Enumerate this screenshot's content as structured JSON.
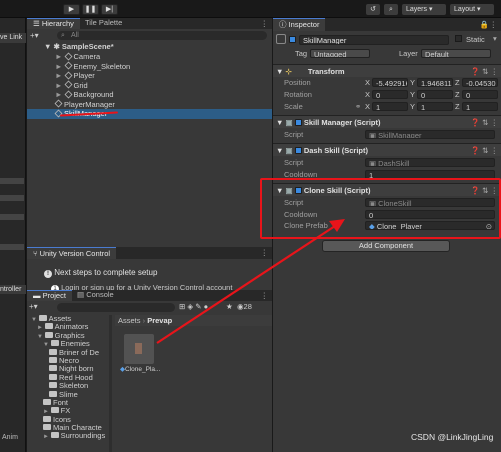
{
  "toolbar": {
    "play_icon": "play-icon",
    "pause_icon": "pause-icon",
    "step_icon": "step-icon",
    "layers_label": "Layers",
    "layout_label": "Layout"
  },
  "leftstrip": {
    "live_link": "ve Link",
    "controller": "ntroller",
    "anim": "Anim"
  },
  "hierarchy": {
    "tab_label": "Hierarchy",
    "tab2_label": "Tile Palette",
    "search_placeholder": "All",
    "scene_name": "SampleScene*",
    "items": [
      "Camera",
      "Enemy_Skeleton",
      "Player",
      "Grid",
      "Background",
      "PlayerManager",
      "SkillManager"
    ]
  },
  "uvc": {
    "tab_label": "Unity Version Control",
    "title": "Next steps to complete setup",
    "step1_num": "1",
    "step1": "Login or sign up for a Unity Version Control account"
  },
  "project": {
    "tab_label": "Project",
    "console_tab": "Console",
    "count": "28",
    "breadcrumb": [
      "Assets",
      "Prevap"
    ],
    "tree": [
      {
        "label": "Assets",
        "indent": 0,
        "arrow": "▼"
      },
      {
        "label": "Animators",
        "indent": 1,
        "arrow": "►"
      },
      {
        "label": "Graphics",
        "indent": 1,
        "arrow": "▼"
      },
      {
        "label": "Enemies",
        "indent": 2,
        "arrow": "▼"
      },
      {
        "label": "Briner of De",
        "indent": 3,
        "arrow": ""
      },
      {
        "label": "Necro",
        "indent": 3,
        "arrow": ""
      },
      {
        "label": "Night born",
        "indent": 3,
        "arrow": ""
      },
      {
        "label": "Red Hood",
        "indent": 3,
        "arrow": ""
      },
      {
        "label": "Skeleton",
        "indent": 3,
        "arrow": ""
      },
      {
        "label": "Slime",
        "indent": 3,
        "arrow": ""
      },
      {
        "label": "Font",
        "indent": 2,
        "arrow": ""
      },
      {
        "label": "FX",
        "indent": 2,
        "arrow": "►"
      },
      {
        "label": "Icons",
        "indent": 2,
        "arrow": ""
      },
      {
        "label": "Main Characte",
        "indent": 2,
        "arrow": ""
      },
      {
        "label": "Surroundings",
        "indent": 2,
        "arrow": "►"
      }
    ],
    "asset_label": "Clone_Pla..."
  },
  "inspector": {
    "tab_label": "Inspector",
    "object_name": "SkillManager",
    "static_label": "Static",
    "tag_label": "Tag",
    "tag_value": "Untagged",
    "layer_label": "Layer",
    "layer_value": "Default",
    "transform": {
      "title": "Transform",
      "position_label": "Position",
      "rotation_label": "Rotation",
      "scale_label": "Scale",
      "pos": [
        "-5.492916",
        "1.946811",
        "-0.04530"
      ],
      "rot": [
        "0",
        "0",
        "0"
      ],
      "scale": [
        "1",
        "1",
        "1"
      ],
      "x": "X",
      "y": "Y",
      "z": "Z"
    },
    "skill_manager": {
      "title": "Skill Manager (Script)",
      "script_label": "Script",
      "script_value": "SkillManager"
    },
    "dash_skill": {
      "title": "Dash Skill (Script)",
      "script_label": "Script",
      "script_value": "DashSkill",
      "cooldown_label": "Cooldown",
      "cooldown_value": "1"
    },
    "clone_skill": {
      "title": "Clone Skill (Script)",
      "script_label": "Script",
      "script_value": "CloneSkill",
      "cooldown_label": "Cooldown",
      "cooldown_value": "0",
      "prefab_label": "Clone Prefab",
      "prefab_value": "Clone_Player"
    },
    "add_component": "Add Component"
  },
  "watermark": "CSDN @LinkJingLing",
  "colors": {
    "highlight_red": "#e8141a",
    "selection_blue": "#2c5d87",
    "accent": "#3a8ae0"
  }
}
